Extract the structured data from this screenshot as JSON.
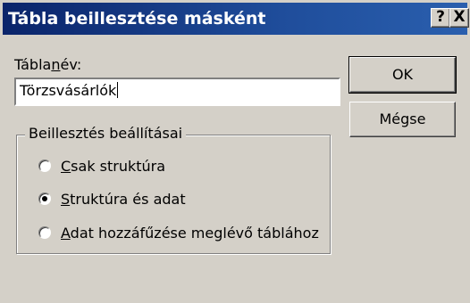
{
  "window": {
    "title": "Tábla beillesztése másként",
    "help_label": "?",
    "close_label": "X"
  },
  "table_name": {
    "label_before": "Tábla",
    "label_underlined": "n",
    "label_after": "év:",
    "value": "Törzsvásárlók"
  },
  "buttons": {
    "ok_label": "OK",
    "cancel_label": "Mégse"
  },
  "paste_options": {
    "group_label": "Beillesztés beállításai",
    "options": [
      {
        "underlined": "C",
        "rest": "sak struktúra",
        "selected": false
      },
      {
        "underlined": "S",
        "rest": "truktúra és adat",
        "selected": true
      },
      {
        "underlined": "A",
        "rest": "dat hozzáfűzése meglévő táblához",
        "selected": false
      }
    ]
  }
}
